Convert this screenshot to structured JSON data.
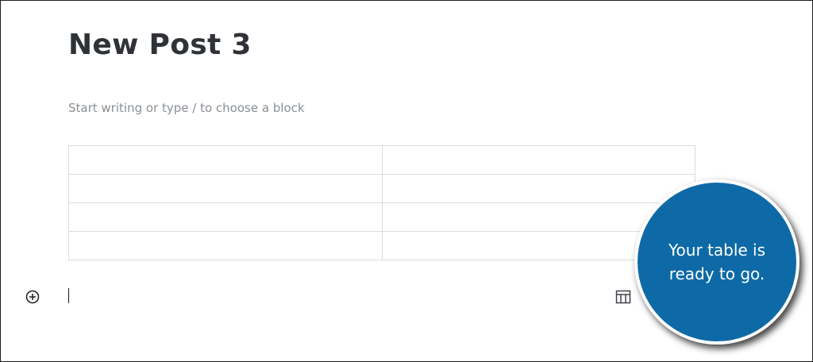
{
  "post": {
    "title": "New Post 3",
    "placeholder": "Start writing or type / to choose a block"
  },
  "table": {
    "rows": [
      [
        "",
        ""
      ],
      [
        "",
        ""
      ],
      [
        "",
        ""
      ],
      [
        "",
        ""
      ]
    ]
  },
  "toolbar": {
    "inserter_icon": "plus-circle-icon",
    "block_icon": "table-icon"
  },
  "callout": {
    "text": "Your table is ready to go.",
    "color": "#0e6aa6"
  }
}
